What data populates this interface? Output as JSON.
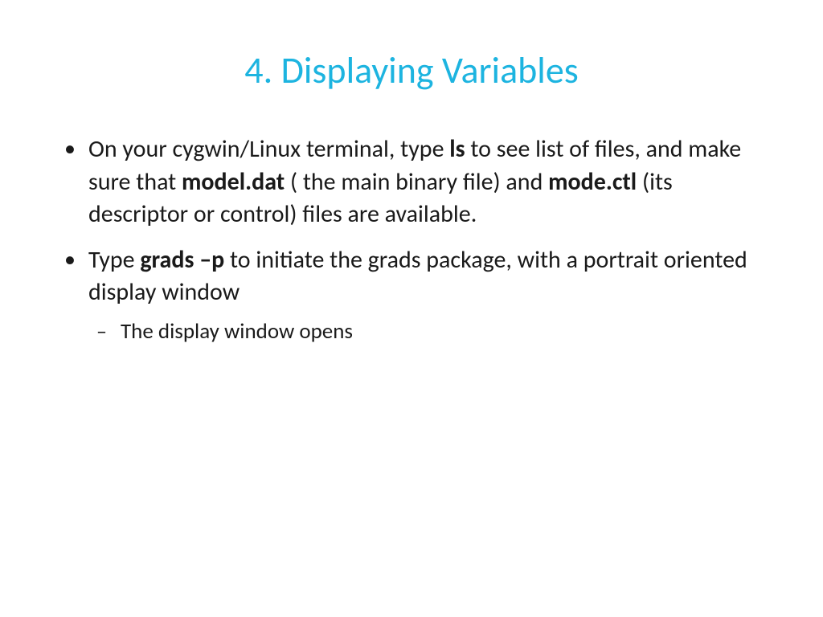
{
  "title": "4. Displaying Variables",
  "bullets": {
    "item1": {
      "part1": "On your cygwin/Linux terminal, type ",
      "bold1": "ls",
      "part2": " to see list of files, and make sure that ",
      "bold2": "model.dat",
      "part3": " ( the main binary file) and ",
      "bold3": "mode.ctl",
      "part4": " (its descriptor or control) files are available."
    },
    "item2": {
      "part1": "Type ",
      "bold1": "grads –p",
      "part2": " to initiate the grads package, with a portrait oriented display window"
    },
    "sub1": "The display window opens"
  }
}
